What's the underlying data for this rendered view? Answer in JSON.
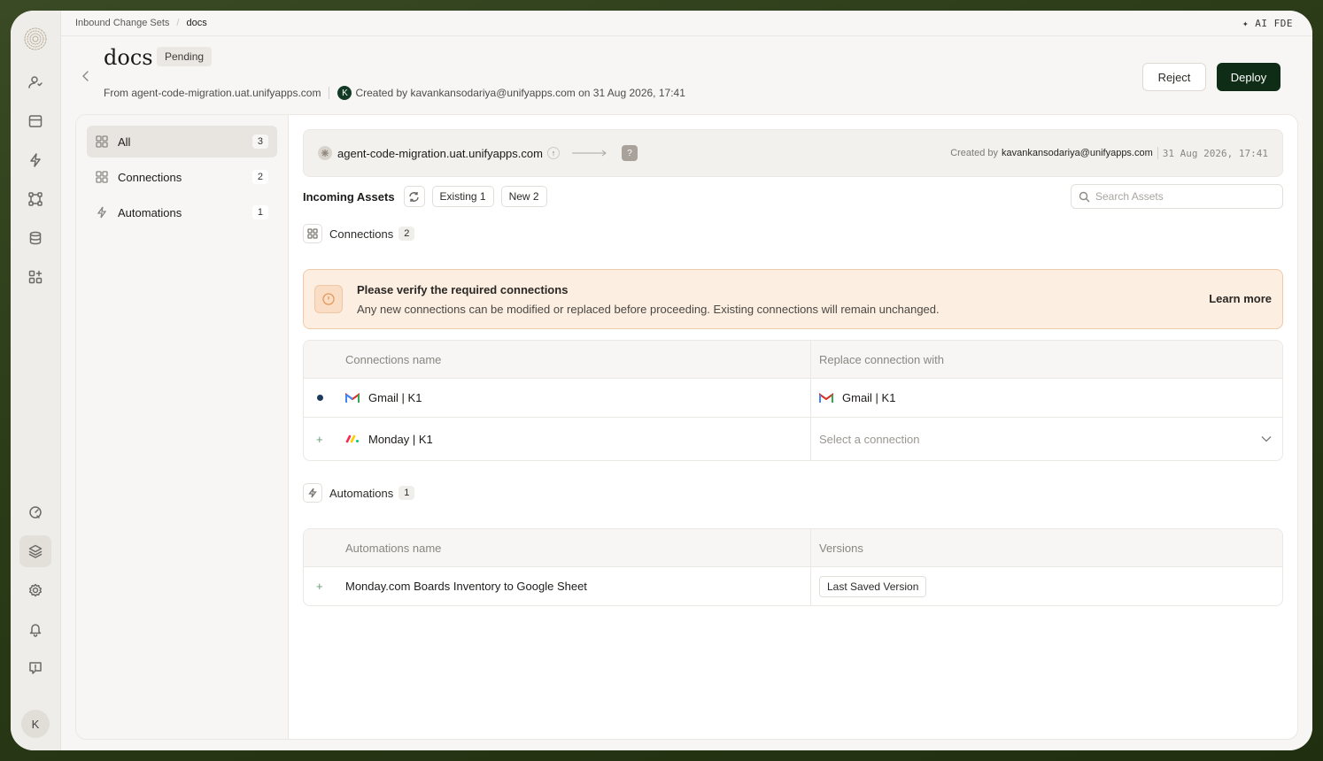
{
  "breadcrumb": {
    "parent": "Inbound Change Sets",
    "current": "docs"
  },
  "ai_label": "✦ AI FDE",
  "header": {
    "title": "docs",
    "status": "Pending",
    "from_text": "From agent-code-migration.uat.unifyapps.com",
    "creator_initial": "K",
    "created_text": "Created by kavankansodariya@unifyapps.com on 31 Aug 2026, 17:41",
    "reject_label": "Reject",
    "deploy_label": "Deploy"
  },
  "sidebar": {
    "items": [
      {
        "label": "All",
        "count": "3"
      },
      {
        "label": "Connections",
        "count": "2"
      },
      {
        "label": "Automations",
        "count": "1"
      }
    ]
  },
  "rail": {
    "avatar_initial": "K"
  },
  "flow": {
    "source": "agent-code-migration.uat.unifyapps.com",
    "target": "?",
    "created_label": "Created by",
    "created_by": "kavankansodariya@unifyapps.com",
    "created_at": "31 Aug 2026, 17:41"
  },
  "assets_bar": {
    "label": "Incoming Assets",
    "existing": "Existing 1",
    "new": "New 2",
    "search_placeholder": "Search Assets"
  },
  "connections": {
    "title": "Connections",
    "count": "2",
    "alert_title": "Please verify the required connections",
    "alert_text": "Any new connections can be modified or replaced before proceeding. Existing connections will remain unchanged.",
    "alert_link": "Learn more",
    "col_name": "Connections name",
    "col_replace": "Replace connection with",
    "rows": [
      {
        "marker": "•",
        "name": "Gmail | K1",
        "replace": "Gmail | K1"
      },
      {
        "marker": "+",
        "name": "Monday | K1",
        "replace": "Select a connection"
      }
    ]
  },
  "automations": {
    "title": "Automations",
    "count": "1",
    "col_name": "Automations name",
    "col_versions": "Versions",
    "rows": [
      {
        "marker": "+",
        "name": "Monday.com Boards Inventory to Google Sheet",
        "version": "Last Saved Version"
      }
    ]
  },
  "colors": {
    "deploy": "#0f2d16",
    "alert_bg": "#fdeee2",
    "accent_green": "#123a24"
  }
}
